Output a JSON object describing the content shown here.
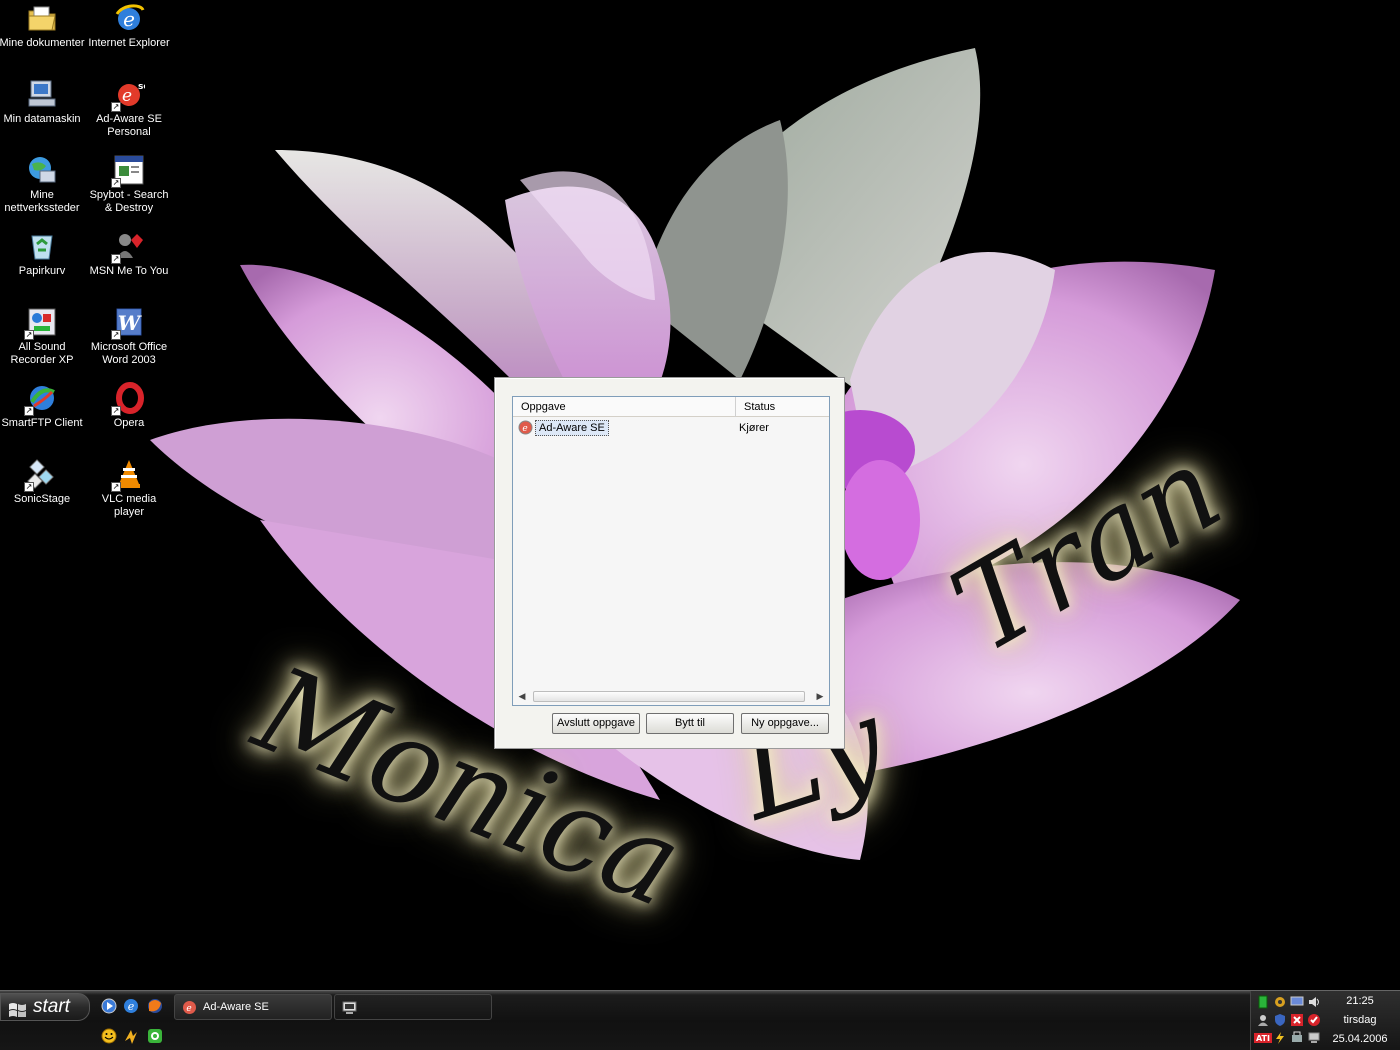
{
  "wallpaper": {
    "signature_word1": "Monica",
    "signature_word2": "Ly",
    "signature_word3": "Tran"
  },
  "desktop_icons": [
    {
      "label": "Mine dokumenter",
      "icon": "folder-documents-icon"
    },
    {
      "label": "Internet Explorer",
      "icon": "internet-explorer-icon"
    },
    {
      "label": "Min datamaskin",
      "icon": "my-computer-icon"
    },
    {
      "label": "Ad-Aware SE Personal",
      "icon": "ad-aware-icon"
    },
    {
      "label": "Mine nettverkssteder",
      "icon": "network-places-icon"
    },
    {
      "label": "Spybot - Search & Destroy",
      "icon": "spybot-icon"
    },
    {
      "label": "Papirkurv",
      "icon": "recycle-bin-icon"
    },
    {
      "label": "MSN Me To You",
      "icon": "msn-icon"
    },
    {
      "label": "All Sound Recorder XP",
      "icon": "sound-recorder-icon"
    },
    {
      "label": "Microsoft Office Word 2003",
      "icon": "word-icon"
    },
    {
      "label": "SmartFTP Client",
      "icon": "smartftp-icon"
    },
    {
      "label": "Opera",
      "icon": "opera-icon"
    },
    {
      "label": "SonicStage",
      "icon": "sonicstage-icon"
    },
    {
      "label": "VLC media player",
      "icon": "vlc-icon"
    }
  ],
  "task_dialog": {
    "columns": {
      "task": "Oppgave",
      "status": "Status"
    },
    "rows": [
      {
        "task": "Ad-Aware SE",
        "status": "Kjører"
      }
    ],
    "buttons": {
      "end_task": "Avslutt oppgave",
      "switch_to": "Bytt til",
      "new_task": "Ny oppgave..."
    }
  },
  "taskbar": {
    "start_label": "start",
    "tasks": [
      {
        "label": "Ad-Aware SE"
      },
      {
        "label": ""
      }
    ],
    "clock": {
      "time": "21:25",
      "day": "tirsdag",
      "date": "25.04.2006"
    }
  },
  "colors": {
    "dialog_bg": "#f3f3ef",
    "selection": "#dde8f7",
    "taskbar": "#161616"
  }
}
